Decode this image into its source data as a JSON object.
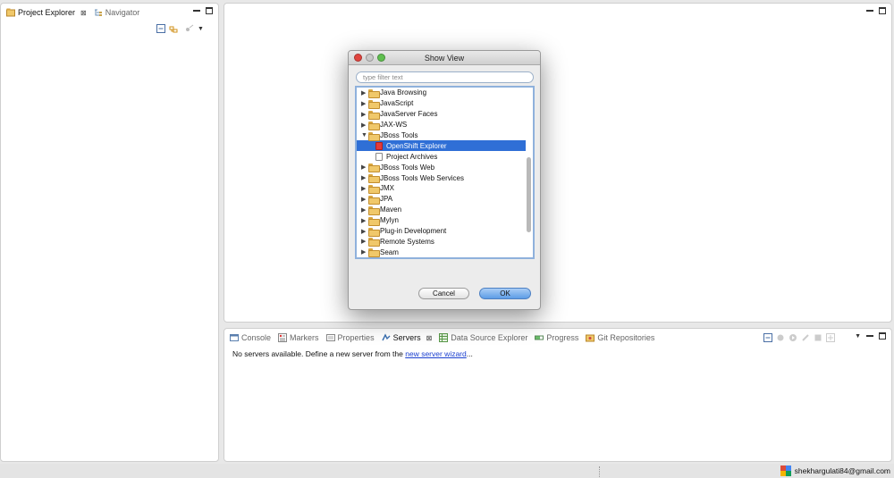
{
  "left_panel": {
    "tabs": [
      {
        "label": "Project Explorer",
        "active": true,
        "close": "⊠"
      },
      {
        "label": "Navigator",
        "active": false
      }
    ]
  },
  "bottom_panel": {
    "tabs": [
      {
        "label": "Console"
      },
      {
        "label": "Markers"
      },
      {
        "label": "Properties"
      },
      {
        "label": "Servers",
        "active": true,
        "close": "⊠"
      },
      {
        "label": "Data Source Explorer"
      },
      {
        "label": "Progress"
      },
      {
        "label": "Git Repositories"
      }
    ],
    "message_prefix": "No servers available. Define a new server from the",
    "message_link": "new server wizard",
    "message_suffix": "..."
  },
  "dialog": {
    "title": "Show View",
    "filter_placeholder": "type filter text",
    "tree": [
      {
        "label": "Java Browsing",
        "level": 0,
        "expanded": false
      },
      {
        "label": "JavaScript",
        "level": 0,
        "expanded": false
      },
      {
        "label": "JavaServer Faces",
        "level": 0,
        "expanded": false
      },
      {
        "label": "JAX-WS",
        "level": 0,
        "expanded": false
      },
      {
        "label": "JBoss Tools",
        "level": 0,
        "expanded": true
      },
      {
        "label": "OpenShift Explorer",
        "level": 1,
        "selected": true
      },
      {
        "label": "Project Archives",
        "level": 1
      },
      {
        "label": "JBoss Tools Web",
        "level": 0,
        "expanded": false
      },
      {
        "label": "JBoss Tools Web Services",
        "level": 0,
        "expanded": false
      },
      {
        "label": "JMX",
        "level": 0,
        "expanded": false
      },
      {
        "label": "JPA",
        "level": 0,
        "expanded": false
      },
      {
        "label": "Maven",
        "level": 0,
        "expanded": false
      },
      {
        "label": "Mylyn",
        "level": 0,
        "expanded": false
      },
      {
        "label": "Plug-in Development",
        "level": 0,
        "expanded": false
      },
      {
        "label": "Remote Systems",
        "level": 0,
        "expanded": false
      },
      {
        "label": "Seam",
        "level": 0,
        "expanded": false
      }
    ],
    "cancel_label": "Cancel",
    "ok_label": "OK"
  },
  "status_bar": {
    "account": "shekhargulati84@gmail.com"
  },
  "colors": {
    "selection": "#2f6fd6",
    "link": "#1a3fcf",
    "ok_button": "#5d9de6"
  }
}
